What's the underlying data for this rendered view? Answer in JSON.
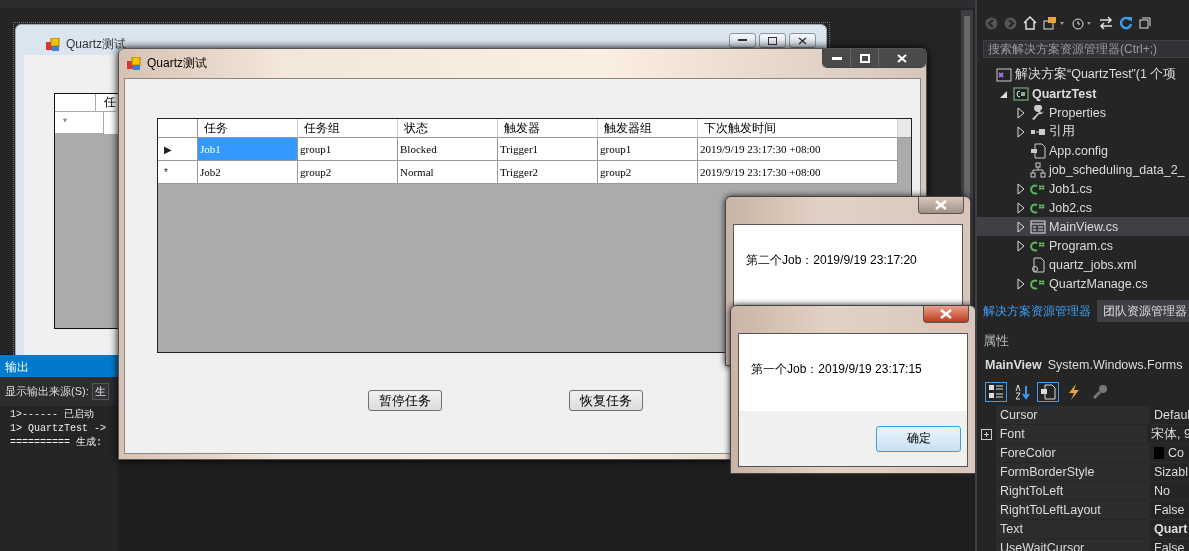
{
  "designer": {
    "form_title": "Quartz测试",
    "grid_header": "任",
    "new_row_marker": "*"
  },
  "output": {
    "title": "输出",
    "source_label": "显示输出来源(S):",
    "source_value": "生",
    "lines": [
      "1>------ 已启动",
      "1>  QuartzTest ->",
      "========== 生成:"
    ]
  },
  "app_window": {
    "title": "Quartz测试",
    "columns": [
      "任务",
      "任务组",
      "状态",
      "触发器",
      "触发器组",
      "下次触发时间"
    ],
    "rows": [
      {
        "marker": "▶",
        "selected": true,
        "cells": [
          "Job1",
          "group1",
          "Blocked",
          "Trigger1",
          "group1",
          "2019/9/19 23:17:30 +08:00"
        ]
      },
      {
        "marker": "*",
        "selected": false,
        "cells": [
          "Job2",
          "group2",
          "Normal",
          "Trigger2",
          "group2",
          "2019/9/19 23:17:30 +08:00"
        ]
      }
    ],
    "buttons": [
      "暂停任务",
      "恢复任务"
    ]
  },
  "dialogs": [
    {
      "message": "第二个Job：2019/9/19 23:17:20",
      "active": false
    },
    {
      "message": "第一个Job：2019/9/19 23:17:15",
      "active": true,
      "button": "确定"
    }
  ],
  "solution_explorer": {
    "search": {
      "placeholder": "搜索解决方案资源管理器(Ctrl+;)"
    },
    "tree": [
      {
        "label": "解决方案“QuartzTest”(1 个项",
        "kind": "solution",
        "selected": false,
        "children": [
          {
            "label": "QuartzTest",
            "kind": "project",
            "expanded": true,
            "selected": false,
            "children": [
              {
                "label": "Properties",
                "kind": "wrench",
                "expanded": false,
                "selected": false
              },
              {
                "label": "引用",
                "kind": "references",
                "expanded": false,
                "selected": false
              },
              {
                "label": "App.config",
                "kind": "config",
                "selected": false
              },
              {
                "label": "job_scheduling_data_2_",
                "kind": "schema",
                "selected": false
              },
              {
                "label": "Job1.cs",
                "kind": "csharp",
                "expanded": false,
                "selected": false
              },
              {
                "label": "Job2.cs",
                "kind": "csharp",
                "expanded": false,
                "selected": false
              },
              {
                "label": "MainView.cs",
                "kind": "form",
                "expanded": false,
                "selected": true
              },
              {
                "label": "Program.cs",
                "kind": "csharp",
                "expanded": false,
                "selected": false
              },
              {
                "label": "quartz_jobs.xml",
                "kind": "file",
                "selected": false
              },
              {
                "label": "QuartzManage.cs",
                "kind": "csharp",
                "expanded": false,
                "selected": false
              }
            ]
          }
        ]
      }
    ],
    "tabs": [
      {
        "label": "解决方案资源管理器",
        "selected": true
      },
      {
        "label": "团队资源管理器",
        "selected": false
      }
    ]
  },
  "properties": {
    "title": "属性",
    "object_name": "MainView",
    "object_type": "System.Windows.Forms",
    "rows": [
      {
        "name": "Cursor",
        "value": "Defaul",
        "modified": false
      },
      {
        "name": "Font",
        "value": "宋体, 9",
        "modified": false,
        "expandable": true
      },
      {
        "name": "ForeColor",
        "value": "Co",
        "modified": false,
        "color": "#000000"
      },
      {
        "name": "FormBorderStyle",
        "value": "Sizabl",
        "modified": false
      },
      {
        "name": "RightToLeft",
        "value": "No",
        "modified": false
      },
      {
        "name": "RightToLeftLayout",
        "value": "False",
        "modified": false
      },
      {
        "name": "Text",
        "value": "Quart",
        "modified": true
      },
      {
        "name": "UseWaitCursor",
        "value": "False",
        "modified": false
      }
    ]
  }
}
